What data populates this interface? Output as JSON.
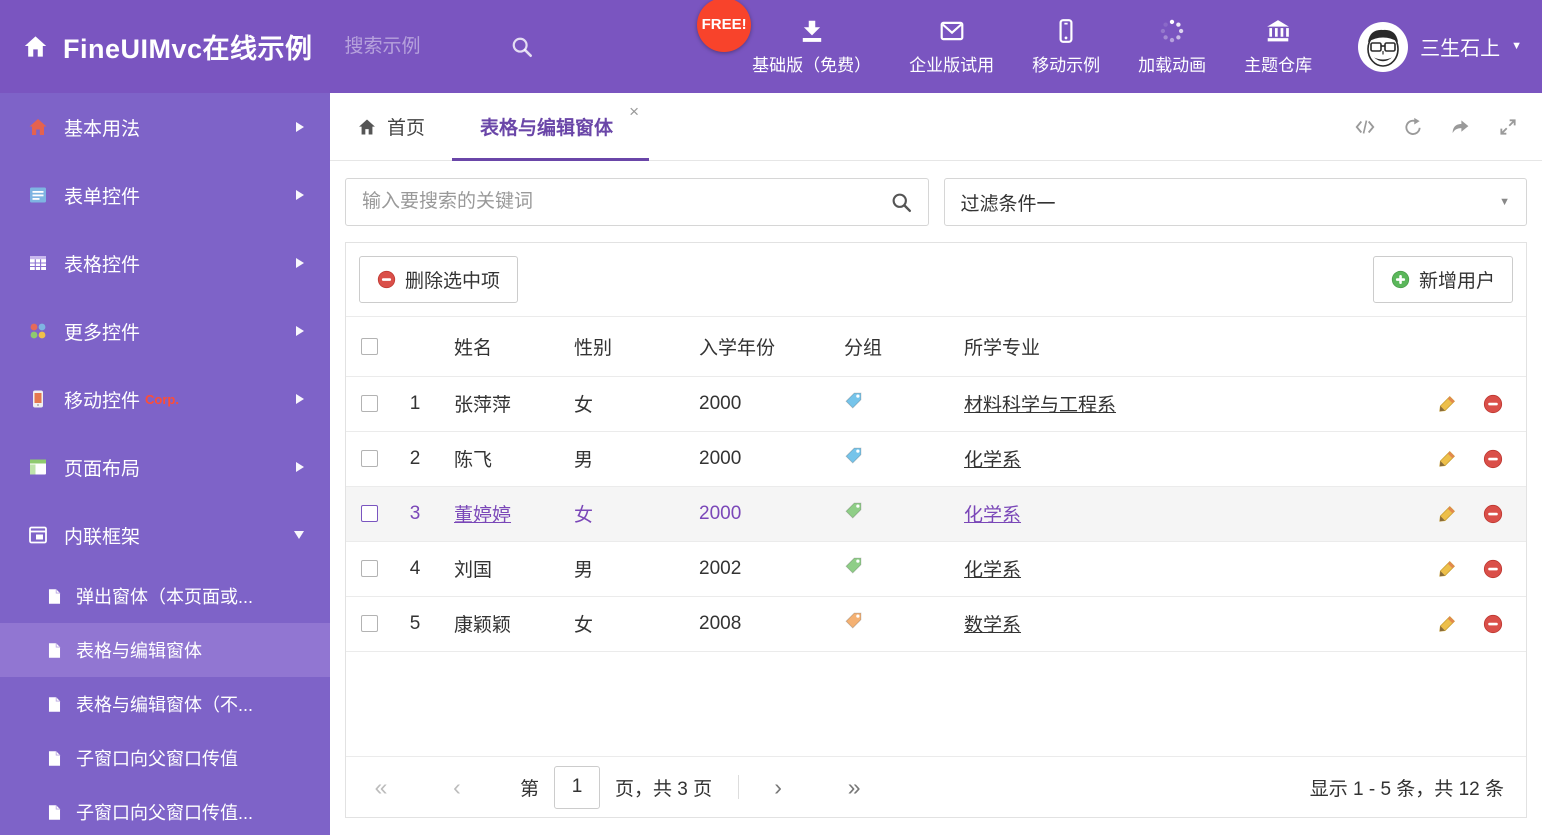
{
  "header": {
    "app_title": "FineUIMvc在线示例",
    "search_placeholder": "搜索示例",
    "free_badge": "FREE!",
    "nav_items": [
      {
        "label": "基础版（免费）"
      },
      {
        "label": "企业版试用"
      },
      {
        "label": "移动示例"
      },
      {
        "label": "加载动画"
      },
      {
        "label": "主题仓库"
      }
    ],
    "user_name": "三生石上"
  },
  "sidebar": {
    "items": [
      {
        "label": "基本用法"
      },
      {
        "label": "表单控件"
      },
      {
        "label": "表格控件"
      },
      {
        "label": "更多控件"
      },
      {
        "label": "移动控件",
        "badge": "Corp."
      },
      {
        "label": "页面布局"
      },
      {
        "label": "内联框架"
      }
    ],
    "subitems": [
      {
        "label": "弹出窗体（本页面或..."
      },
      {
        "label": "表格与编辑窗体"
      },
      {
        "label": "表格与编辑窗体（不..."
      },
      {
        "label": "子窗口向父窗口传值"
      },
      {
        "label": "子窗口向父窗口传值..."
      }
    ]
  },
  "tabs": {
    "home": "首页",
    "active_tab": "表格与编辑窗体"
  },
  "filters": {
    "search_placeholder": "输入要搜索的关键词",
    "filter_selected": "过滤条件一"
  },
  "toolbar": {
    "delete_button": "删除选中项",
    "add_button": "新增用户"
  },
  "table": {
    "columns": {
      "name": "姓名",
      "gender": "性别",
      "year": "入学年份",
      "group": "分组",
      "major": "所学专业"
    },
    "rows": [
      {
        "num": "1",
        "name": "张萍萍",
        "gender": "女",
        "year": "2000",
        "major": "材料科学与工程系",
        "tag_color": "#76c4ea"
      },
      {
        "num": "2",
        "name": "陈飞",
        "gender": "男",
        "year": "2000",
        "major": "化学系",
        "tag_color": "#76c4ea"
      },
      {
        "num": "3",
        "name": "董婷婷",
        "gender": "女",
        "year": "2000",
        "major": "化学系",
        "tag_color": "#8fce87"
      },
      {
        "num": "4",
        "name": "刘国",
        "gender": "男",
        "year": "2002",
        "major": "化学系",
        "tag_color": "#8fce87"
      },
      {
        "num": "5",
        "name": "康颖颖",
        "gender": "女",
        "year": "2008",
        "major": "数学系",
        "tag_color": "#f4b173"
      }
    ]
  },
  "pagination": {
    "page_prefix": "第",
    "current_page": "1",
    "page_suffix": "页，共 3 页",
    "summary": "显示 1 - 5 条，共 12 条"
  },
  "icons": {
    "close": "×",
    "caret_down": "▼",
    "page_first": "«",
    "page_prev": "‹",
    "page_next": "›",
    "page_last": "»"
  },
  "colors": {
    "header_bg": "#7a55c0",
    "sidebar_bg": "#7e63c8",
    "sidebar_active_bg": "#9176d2",
    "accent_purple": "#6a46a8",
    "selected_row_text": "#7a47b8",
    "free_badge_bg": "#f8432b",
    "delete_red": "#da4f49",
    "add_green": "#5bb75b",
    "corp_badge_red": "#ff4d35"
  }
}
